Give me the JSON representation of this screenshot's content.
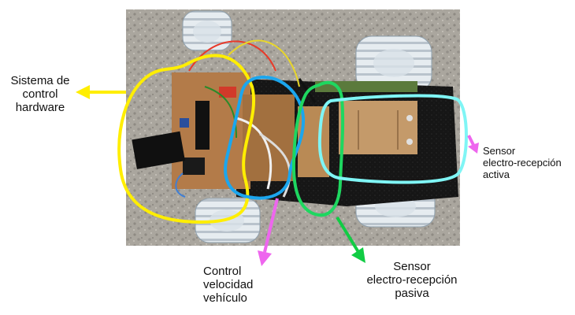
{
  "annotations": {
    "hardware": {
      "lines": [
        "Sistema de",
        "control",
        "hardware"
      ],
      "color": "#ffee00"
    },
    "speed": {
      "lines": [
        "Control",
        "velocidad",
        "vehículo"
      ],
      "color": "#1ba6ee"
    },
    "passive": {
      "lines": [
        "Sensor",
        "electro-recepción",
        "pasiva"
      ],
      "color": "#1ed760"
    },
    "active": {
      "lines": [
        "Sensor",
        "electro-recepción",
        "activa"
      ],
      "color": "#7ff5f5"
    }
  },
  "arrow_colors": {
    "yellow": "#ffee00",
    "magenta": "#ee66ee",
    "green": "#11cc44"
  },
  "photo": {
    "subject": "robot-car-top-view",
    "ground_color": "#a8a49c",
    "board_color": "#b07a4a"
  }
}
